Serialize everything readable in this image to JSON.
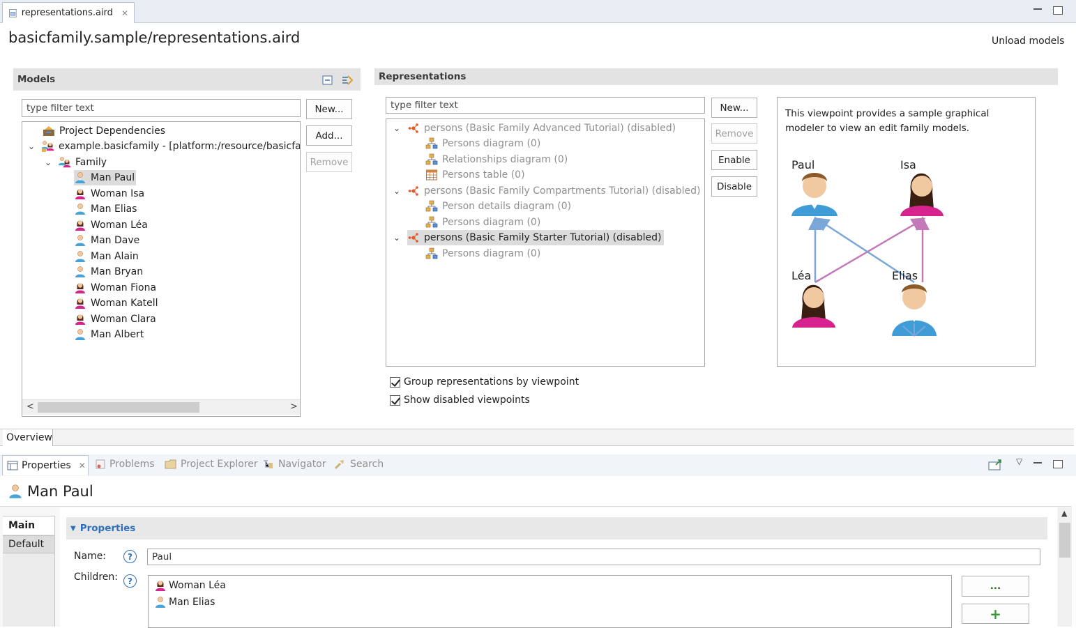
{
  "editor": {
    "tab_label": "representations.aird",
    "title": "basicfamily.sample/representations.aird",
    "unload_label": "Unload models",
    "bottom_tab": "Overview"
  },
  "models": {
    "header": "Models",
    "filter_placeholder": "type filter text",
    "buttons": {
      "new": "New...",
      "add": "Add...",
      "remove": "Remove"
    },
    "tree": [
      {
        "label": "Project Dependencies",
        "icon": "project-dependencies-icon"
      },
      {
        "label": "example.basicfamily - [platform:/resource/basicfam",
        "icon": "family-resource-icon"
      },
      {
        "label": "Family",
        "icon": "family-icon"
      },
      {
        "label": "Man Paul",
        "icon": "man-icon"
      },
      {
        "label": "Woman Isa",
        "icon": "woman-icon"
      },
      {
        "label": "Man Elias",
        "icon": "man-icon"
      },
      {
        "label": "Woman Léa",
        "icon": "woman-icon"
      },
      {
        "label": "Man Dave",
        "icon": "man-icon"
      },
      {
        "label": "Man Alain",
        "icon": "man-icon"
      },
      {
        "label": "Man Bryan",
        "icon": "man-icon"
      },
      {
        "label": "Woman Fiona",
        "icon": "woman-icon"
      },
      {
        "label": "Woman Katell",
        "icon": "woman-icon"
      },
      {
        "label": "Woman Clara",
        "icon": "woman-icon"
      },
      {
        "label": "Man Albert",
        "icon": "man-icon"
      }
    ]
  },
  "representations": {
    "header": "Representations",
    "filter_placeholder": "type filter text",
    "buttons": {
      "new": "New...",
      "remove": "Remove",
      "enable": "Enable",
      "disable": "Disable"
    },
    "tree": [
      {
        "label": "persons (Basic Family Advanced Tutorial) (disabled)",
        "icon": "viewpoint-icon"
      },
      {
        "label": "Persons diagram (0)",
        "icon": "diagram-icon"
      },
      {
        "label": "Relationships diagram (0)",
        "icon": "diagram-icon"
      },
      {
        "label": "Persons table (0)",
        "icon": "table-icon"
      },
      {
        "label": "persons (Basic Family Compartments Tutorial) (disabled)",
        "icon": "viewpoint-icon"
      },
      {
        "label": "Person details diagram (0)",
        "icon": "diagram-icon"
      },
      {
        "label": "Persons diagram (0)",
        "icon": "diagram-icon"
      },
      {
        "label": "persons (Basic Family Starter Tutorial) (disabled)",
        "icon": "viewpoint-icon"
      },
      {
        "label": "Persons diagram (0)",
        "icon": "diagram-icon"
      }
    ],
    "description": "This viewpoint provides a sample graphical modeler to view an edit family models.",
    "preview_names": {
      "paul": "Paul",
      "isa": "Isa",
      "lea": "Léa",
      "elias": "Elias"
    },
    "group_label": "Group representations by viewpoint",
    "show_disabled_label": "Show disabled viewpoints"
  },
  "views_tabs": [
    {
      "label": "Properties",
      "icon": "properties-icon"
    },
    {
      "label": "Problems",
      "icon": "problems-icon"
    },
    {
      "label": "Project Explorer",
      "icon": "project-explorer-icon"
    },
    {
      "label": "Navigator",
      "icon": "navigator-icon"
    },
    {
      "label": "Search",
      "icon": "search-icon"
    }
  ],
  "properties": {
    "title": "Man Paul",
    "side_tabs": {
      "main": "Main",
      "default": "Default"
    },
    "section": "Properties",
    "name_label": "Name:",
    "name_value": "Paul",
    "children_label": "Children:",
    "children": [
      "Woman Léa",
      "Man Elias"
    ],
    "browse_label": "..."
  },
  "colors": {
    "selection": "#dcdcdc",
    "link": "#2c6fbd",
    "man": "#4aa3d6",
    "woman": "#d6238d"
  }
}
